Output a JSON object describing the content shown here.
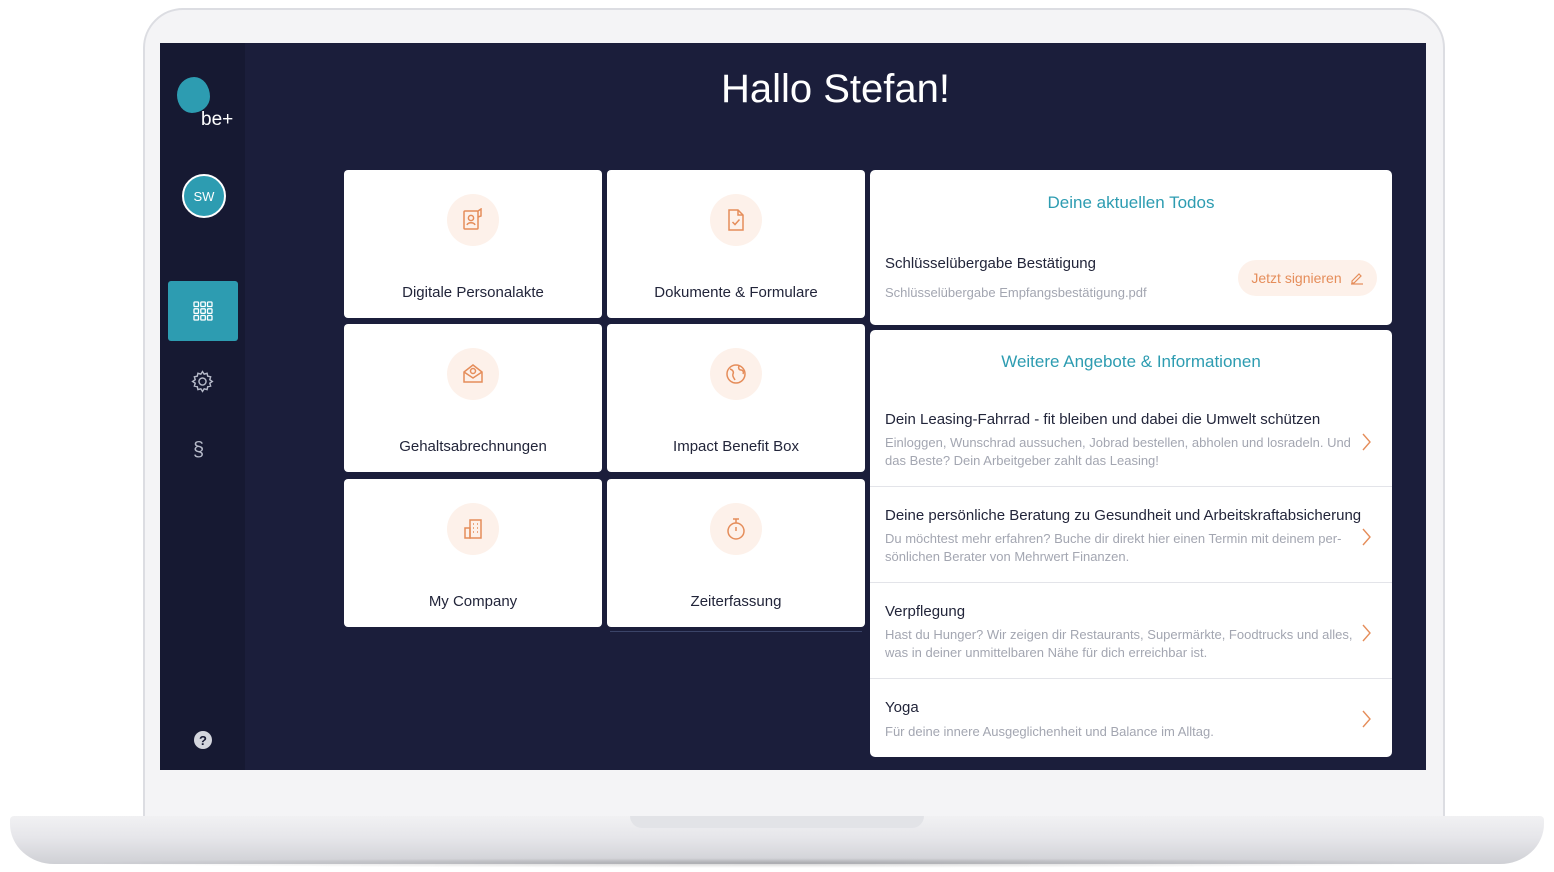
{
  "sidebar": {
    "logo_text": "be+",
    "avatar_initials": "SW",
    "legal_symbol": "§",
    "help_symbol": "?"
  },
  "greeting": "Hallo Stefan!",
  "tiles": [
    {
      "label": "Digitale Personalakte",
      "icon": "personnel-file-icon"
    },
    {
      "label": "Dokumente & Formulare",
      "icon": "document-check-icon"
    },
    {
      "label": "Gehaltsabrechnungen",
      "icon": "payroll-envelope-icon"
    },
    {
      "label": "Impact Benefit Box",
      "icon": "globe-icon"
    },
    {
      "label": "My Company",
      "icon": "building-icon"
    },
    {
      "label": "Zeiterfassung",
      "icon": "stopwatch-icon"
    }
  ],
  "todos": {
    "title": "Deine aktuellen Todos",
    "item": {
      "name": "Schlüsselübergabe Bestätigung",
      "file": "Schlüsselübergabe Empfangsbestätigung.pdf",
      "action_label": "Jetzt signieren"
    }
  },
  "offers": {
    "title": "Weitere Angebote & Informationen",
    "items": [
      {
        "title": "Dein Leasing-Fahrrad - fit bleiben und dabei die Umwelt schützen",
        "desc": "Einloggen, Wunschrad aussuchen, Jobrad bestellen, abholen und losradeln. Und das Beste? Dein Arbeitgeber zahlt das Leasing!"
      },
      {
        "title": "Deine persönliche Beratung zu Gesundheit und Arbeitskraftabsicherung",
        "desc": "Du möchtest mehr erfahren? Buche dir direkt hier einen Termin mit deinem per-sönlichen Berater von Mehrwert Finanzen."
      },
      {
        "title": "Verpflegung",
        "desc": "Hast du Hunger? Wir zeigen dir Restaurants, Supermärkte, Foodtrucks und alles, was in deiner unmittelbaren Nähe für dich erreichbar ist."
      },
      {
        "title": "Yoga",
        "desc": "Für deine innere Ausgeglichenheit und Balance im Alltag."
      }
    ]
  },
  "colors": {
    "background": "#1b1e3b",
    "sidebar": "#161932",
    "accent": "#2d9cb1",
    "icon_orange": "#e58d5a",
    "icon_bg": "#fdf1ea"
  }
}
